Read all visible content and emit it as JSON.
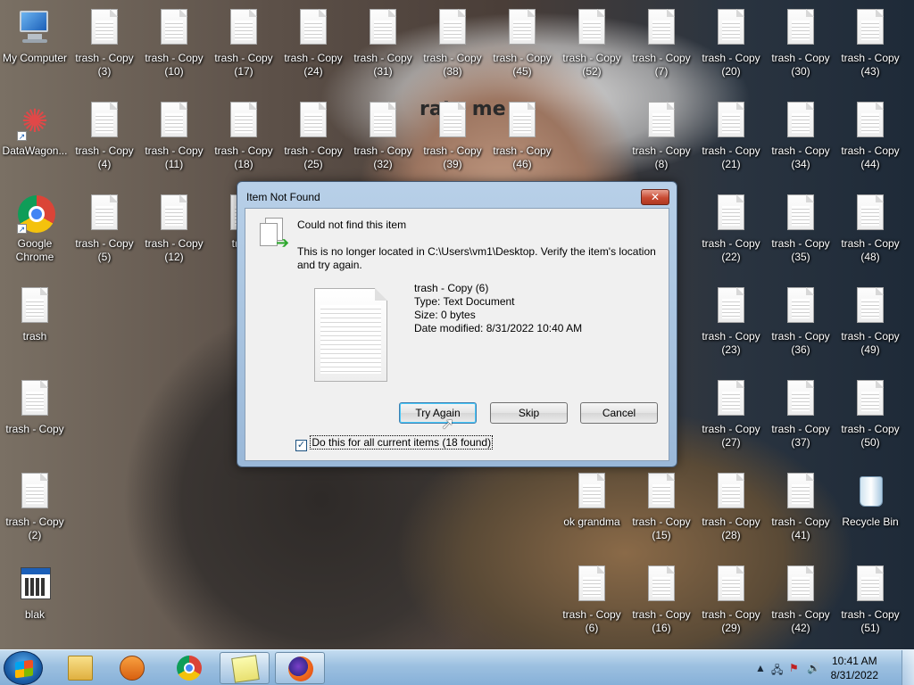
{
  "wallpaper": {
    "overlay_text": "rate me"
  },
  "desktop_icons_left": [
    {
      "label": "My Computer",
      "kind": "computer"
    },
    {
      "label": "DataWagon...",
      "kind": "datawagon"
    },
    {
      "label": "Google\nChrome",
      "kind": "chrome"
    },
    {
      "label": "trash",
      "kind": "doc"
    },
    {
      "label": "trash - Copy",
      "kind": "doc"
    },
    {
      "label": "trash - Copy\n(2)",
      "kind": "doc"
    },
    {
      "label": "blak",
      "kind": "app"
    }
  ],
  "desktop_icons_grid": [
    {
      "label": "trash - Copy\n(3)"
    },
    {
      "label": "trash - Copy\n(10)"
    },
    {
      "label": "trash - Copy\n(17)"
    },
    {
      "label": "trash - Copy\n(24)"
    },
    {
      "label": "trash - Copy\n(31)"
    },
    {
      "label": "trash - Copy\n(38)"
    },
    {
      "label": "trash - Copy\n(45)"
    },
    {
      "label": "trash - Copy\n(52)"
    },
    {
      "label": "trash - Copy\n(7)"
    },
    {
      "label": "trash - Copy\n(20)"
    },
    {
      "label": "trash - Copy\n(30)"
    },
    {
      "label": "trash - Copy\n(43)"
    },
    {
      "label": "trash - Copy\n(4)"
    },
    {
      "label": "trash - Copy\n(11)"
    },
    {
      "label": "trash - Copy\n(18)"
    },
    {
      "label": "trash - Copy\n(25)"
    },
    {
      "label": "trash - Copy\n(32)"
    },
    {
      "label": "trash - Copy\n(39)"
    },
    {
      "label": "trash - Copy\n(46)"
    },
    {
      "label": "trash - Copy\n(8)"
    },
    {
      "label": "trash - Copy\n(21)"
    },
    {
      "label": "trash - Copy\n(34)"
    },
    {
      "label": "trash - Copy\n(44)"
    },
    {
      "label": "trash - Copy\n(5)"
    },
    {
      "label": "trash - Copy\n(12)"
    },
    {
      "label": "trash"
    },
    {
      "label": "trash - Copy\n(22)"
    },
    {
      "label": "trash - Copy\n(35)"
    },
    {
      "label": "trash - Copy\n(48)"
    },
    {
      "label": "trash - Copy\n(23)"
    },
    {
      "label": "trash - Copy\n(36)"
    },
    {
      "label": "trash - Copy\n(49)"
    },
    {
      "label": "trash - Copy\n(27)"
    },
    {
      "label": "trash - Copy\n(37)"
    },
    {
      "label": "trash - Copy\n(50)"
    },
    {
      "label": "ok grandma"
    },
    {
      "label": "trash - Copy\n(15)"
    },
    {
      "label": "trash - Copy\n(28)"
    },
    {
      "label": "trash - Copy\n(41)"
    },
    {
      "label": "Recycle Bin"
    },
    {
      "label": "trash - Copy\n(6)"
    },
    {
      "label": "trash - Copy\n(16)"
    },
    {
      "label": "trash - Copy\n(29)"
    },
    {
      "label": "trash - Copy\n(42)"
    },
    {
      "label": "trash - Copy\n(51)"
    }
  ],
  "dialog": {
    "title": "Item Not Found",
    "close_label": "✕",
    "heading": "Could not find this item",
    "message": "This is no longer located in C:\\Users\\vm1\\Desktop. Verify the item's location and try again.",
    "file": {
      "name": "trash - Copy (6)",
      "type": "Type: Text Document",
      "size": "Size: 0 bytes",
      "modified": "Date modified: 8/31/2022 10:40 AM"
    },
    "buttons": {
      "try_again": "Try Again",
      "skip": "Skip",
      "cancel": "Cancel"
    },
    "checkbox": {
      "checked": true,
      "label": "Do this for all current items (18 found)"
    }
  },
  "taskbar": {
    "clock_time": "10:41 AM",
    "clock_date": "8/31/2022",
    "apps": [
      "windows-explorer-icon",
      "media-player-icon",
      "chrome-icon",
      "sticky-notes-icon",
      "firefox-icon"
    ]
  }
}
